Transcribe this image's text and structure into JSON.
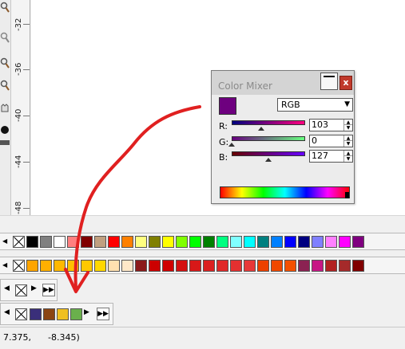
{
  "ruler": {
    "labels": [
      "-32",
      "-36",
      "-40",
      "-44",
      "-48"
    ]
  },
  "color_mixer": {
    "title": "Color Mixer",
    "close_glyph": "x",
    "mode": "RGB",
    "current_color": "#6e007f",
    "channels": [
      {
        "label": "R:",
        "value": "103",
        "gradient_from": "#00007f",
        "gradient_to": "#ff007f",
        "level": 0.404
      },
      {
        "label": "G:",
        "value": "0",
        "gradient_from": "#67007f",
        "gradient_to": "#67ff7f",
        "level": 0.0
      },
      {
        "label": "B:",
        "value": "127",
        "gradient_from": "#670000",
        "gradient_to": "#6700ff",
        "level": 0.498
      }
    ]
  },
  "palettes": {
    "row1": [
      "#000000",
      "#808080",
      "#ffffff",
      "#ff8080",
      "#800000",
      "#c0a080",
      "#ff0000",
      "#ff8000",
      "#ffff80",
      "#808000",
      "#ffff00",
      "#80ff00",
      "#00ff00",
      "#008000",
      "#00ff80",
      "#80ffff",
      "#00ffff",
      "#008080",
      "#0080ff",
      "#0000ff",
      "#000080",
      "#8080ff",
      "#ff80ff",
      "#ff00ff",
      "#800080"
    ],
    "row2": [
      "#ffa500",
      "#ffb000",
      "#ffb800",
      "#ffc000",
      "#ffc800",
      "#ffd800",
      "#ffe0b0",
      "#ffe8c8",
      "#8b1a1a",
      "#cc0000",
      "#d00000",
      "#d41010",
      "#d81818",
      "#dc2020",
      "#e02828",
      "#e43030",
      "#e83838",
      "#ec4000",
      "#f04800",
      "#f45000",
      "#8b2252",
      "#c71585",
      "#b22222",
      "#a52a2a",
      "#800000"
    ],
    "row4": [
      "#3a2f7a",
      "#8b4513",
      "#f0c020",
      "#6ab04c"
    ]
  },
  "status": {
    "x": "7.375,",
    "y": "-8.345)"
  }
}
